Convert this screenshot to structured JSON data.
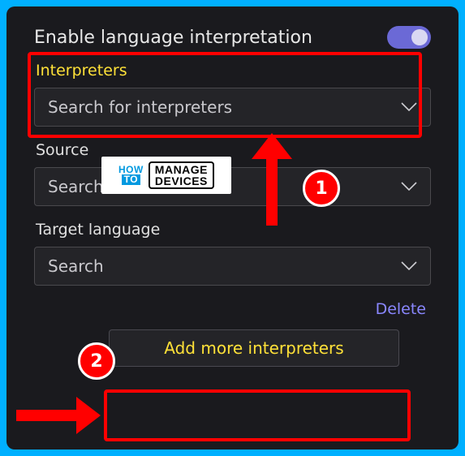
{
  "annotations": {
    "badge1": "1",
    "badge2": "2"
  },
  "watermark": {
    "w1": "HOW",
    "w2": "TO",
    "w3": "MANAGE",
    "w4": "DEVICES"
  },
  "settings": {
    "enable_label": "Enable language interpretation",
    "enable_on": true,
    "interpreters": {
      "label": "Interpreters",
      "placeholder": "Search for interpreters"
    },
    "source": {
      "label": "Source",
      "placeholder": "Search"
    },
    "target": {
      "label": "Target language",
      "placeholder": "Search"
    },
    "delete_label": "Delete",
    "add_label": "Add more interpreters"
  }
}
